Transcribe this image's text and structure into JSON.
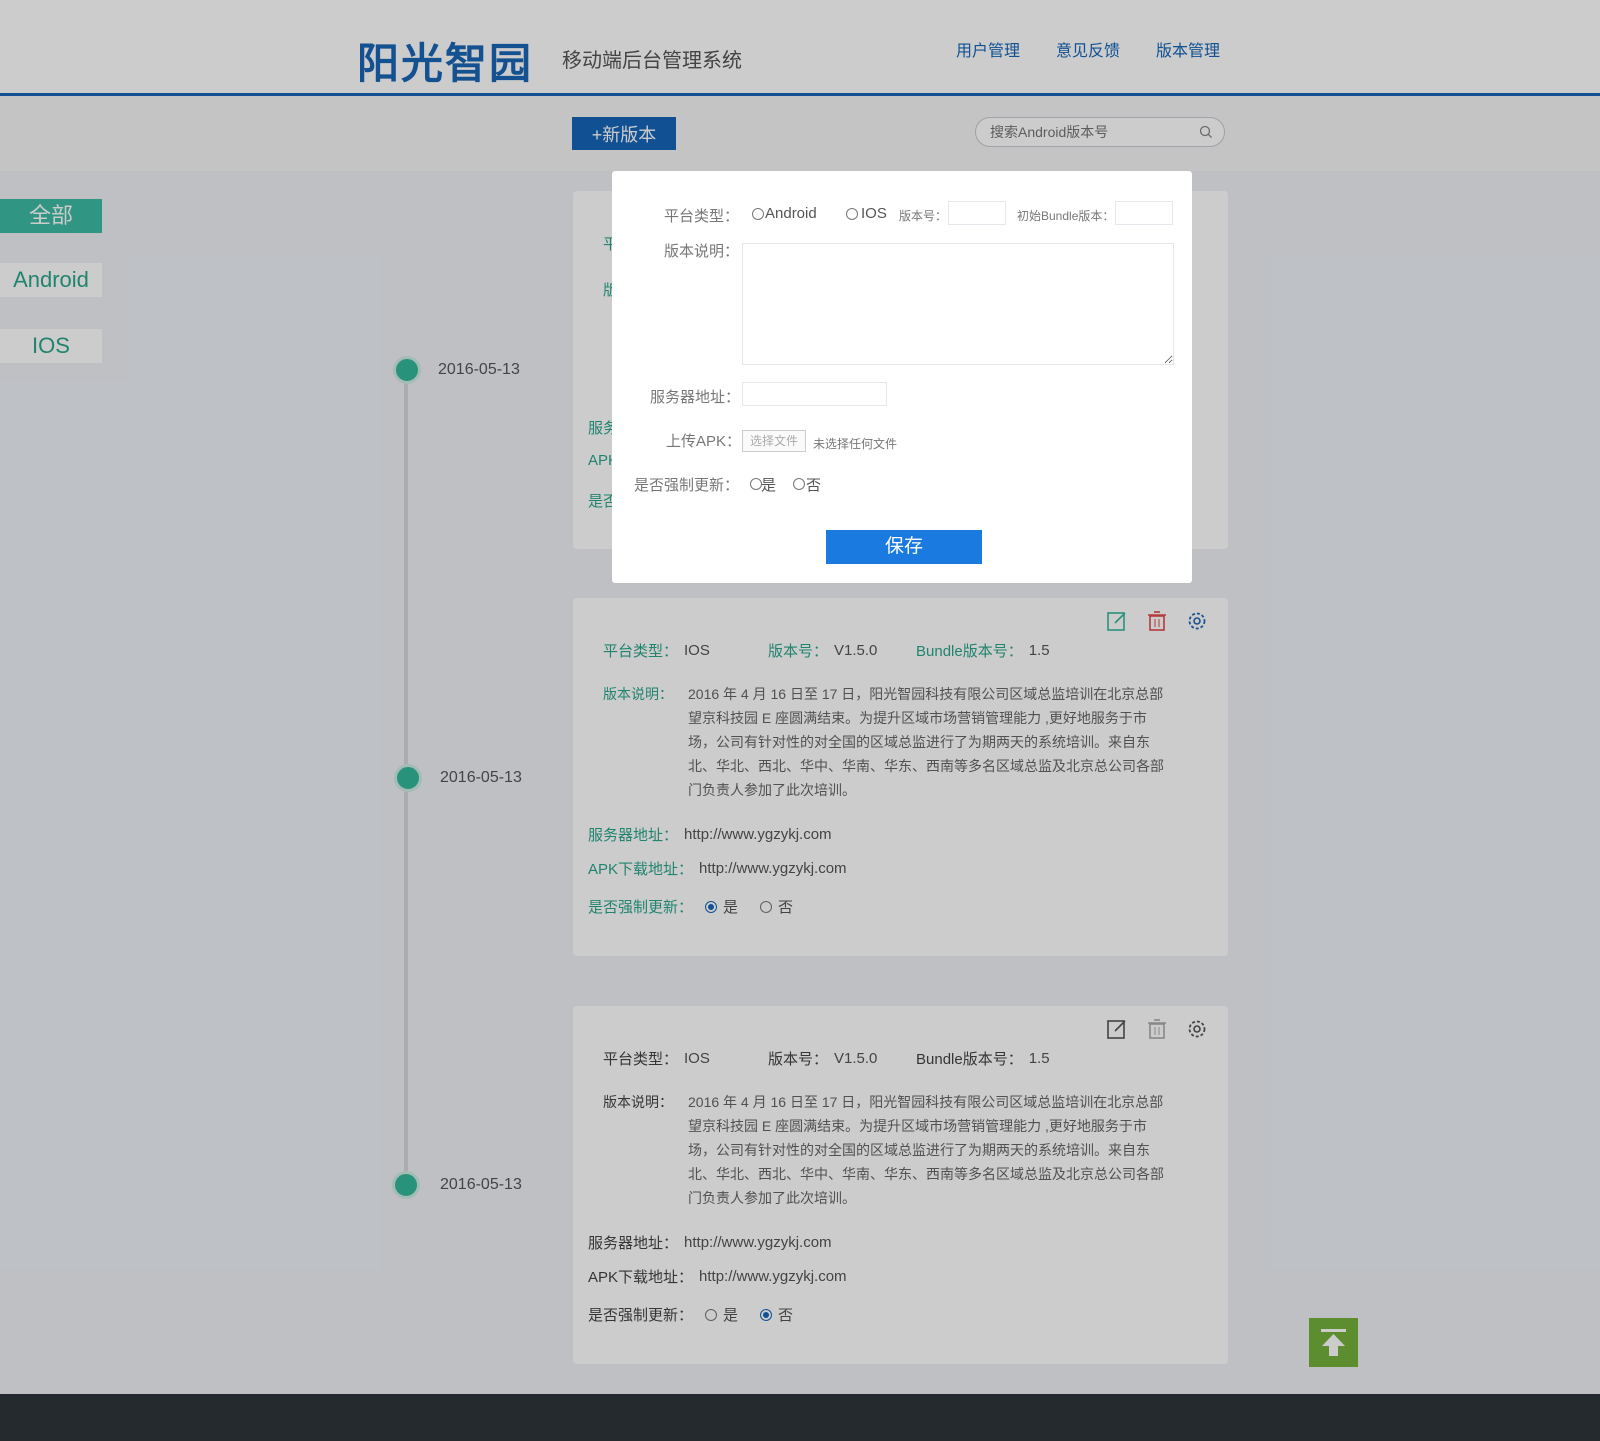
{
  "header": {
    "logo": "阳光智园",
    "subtitle": "移动端后台管理系统",
    "nav": [
      "用户管理",
      "意见反馈",
      "版本管理"
    ]
  },
  "toolbar": {
    "new_label": "+新版本",
    "search_placeholder": "搜索Android版本号"
  },
  "sidebar": {
    "tabs": [
      "全部",
      "Android",
      "IOS"
    ]
  },
  "timeline": {
    "dates": [
      "2016-05-13",
      "2016-05-13",
      "2016-05-13"
    ]
  },
  "cards": [
    {
      "platform_label": "平台类型：",
      "platform": "IOS",
      "version_label": "版本号：",
      "version": "V1.5.0",
      "bundle_label": "Bundle版本号：",
      "bundle": "1.5",
      "desc_label": "版本说明：",
      "desc": "2016 年 4 月 16 日至 17 日，阳光智园科技有限公司区域总监培训在北京总部望京科技园 E 座圆满结束。为提升区域市场营销管理能力 ,更好地服务于市场，公司有针对性的对全国的区域总监进行了为期两天的系统培训。来自东北、华北、西北、华中、华南、华东、西南等多名区域总监及北京总公司各部门负责人参加了此次培训。",
      "server_label": "服务器地址：",
      "server": "http://www.ygzykj.com",
      "apk_label": "APK下载地址：",
      "apk": "http://www.ygzykj.com",
      "force_label": "是否强制更新：",
      "yes": "是",
      "no": "否"
    },
    {
      "platform_label": "平台类型：",
      "platform": "IOS",
      "version_label": "版本号：",
      "version": "V1.5.0",
      "bundle_label": "Bundle版本号：",
      "bundle": "1.5",
      "desc_label": "版本说明：",
      "desc": "2016 年 4 月 16 日至 17 日，阳光智园科技有限公司区域总监培训在北京总部望京科技园 E 座圆满结束。为提升区域市场营销管理能力 ,更好地服务于市场，公司有针对性的对全国的区域总监进行了为期两天的系统培训。来自东北、华北、西北、华中、华南、华东、西南等多名区域总监及北京总公司各部门负责人参加了此次培训。",
      "server_label": "服务器地址：",
      "server": "http://www.ygzykj.com",
      "apk_label": "APK下载地址：",
      "apk": "http://www.ygzykj.com",
      "force_label": "是否强制更新：",
      "yes": "是",
      "no": "否"
    }
  ],
  "card0_partial": {
    "platform_stub": "平",
    "desc_stub": "版",
    "server_stub": "服务",
    "apk_stub": "APK",
    "force_stub": "是否"
  },
  "modal": {
    "platform_label": "平台类型：",
    "opt_android": "Android",
    "opt_ios": "IOS",
    "version_label": "版本号：",
    "bundle_label": "初始Bundle版本：",
    "desc_label": "版本说明：",
    "server_label": "服务器地址：",
    "upload_label": "上传APK：",
    "file_button": "选择文件",
    "file_status": "未选择任何文件",
    "force_label": "是否强制更新：",
    "yes": "是",
    "no": "否",
    "save": "保存"
  },
  "colors": {
    "primary": "#1565b8",
    "teal": "#34b79a",
    "save": "#1a7ae0",
    "delete_red": "#e04b4b",
    "top_button": "#74b13a",
    "footer": "#2e343b"
  }
}
